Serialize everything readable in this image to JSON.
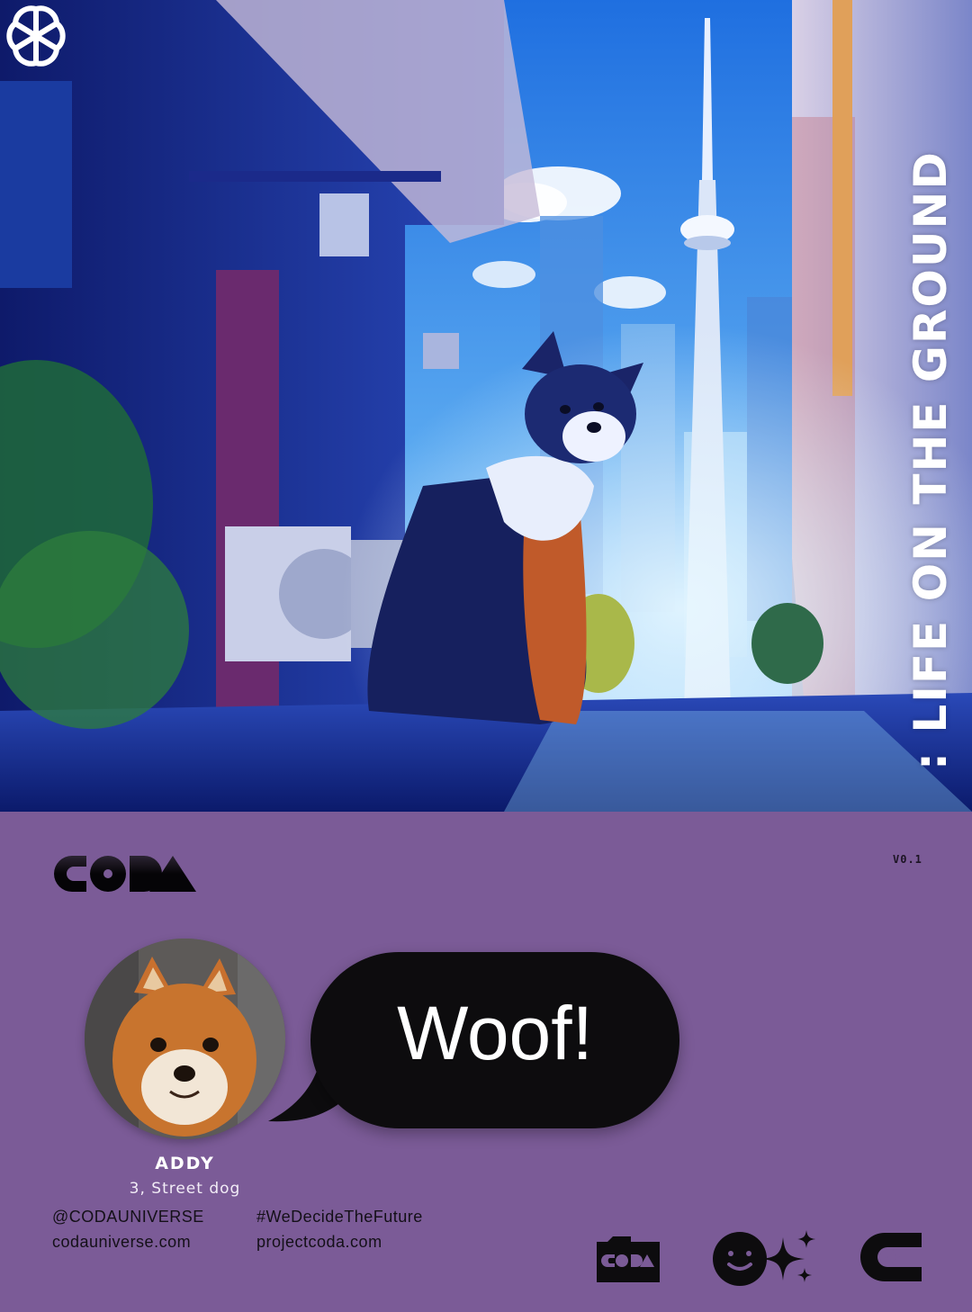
{
  "hero": {
    "vertical_title": ": LIFE ON THE GROUND",
    "scene": "shiba dog sitting in a blue city alley with a tall tower"
  },
  "brand": {
    "version": "V0.1"
  },
  "character": {
    "name": "ADDY",
    "description": "3, Street dog",
    "speech": "Woof!"
  },
  "footer": {
    "handle": "@CODAUNIVERSE",
    "site1": "codauniverse.com",
    "hashtag": "#WeDecideTheFuture",
    "site2": "projectcoda.com"
  },
  "colors": {
    "panel": "#7b5b97",
    "bubble": "#0d0c0e",
    "ink": "#141018"
  },
  "icons": [
    "openai-logo-icon",
    "coda-wordmark-icon",
    "coda-badge-icon",
    "smile-sparkle-icon",
    "c-star-icon"
  ]
}
